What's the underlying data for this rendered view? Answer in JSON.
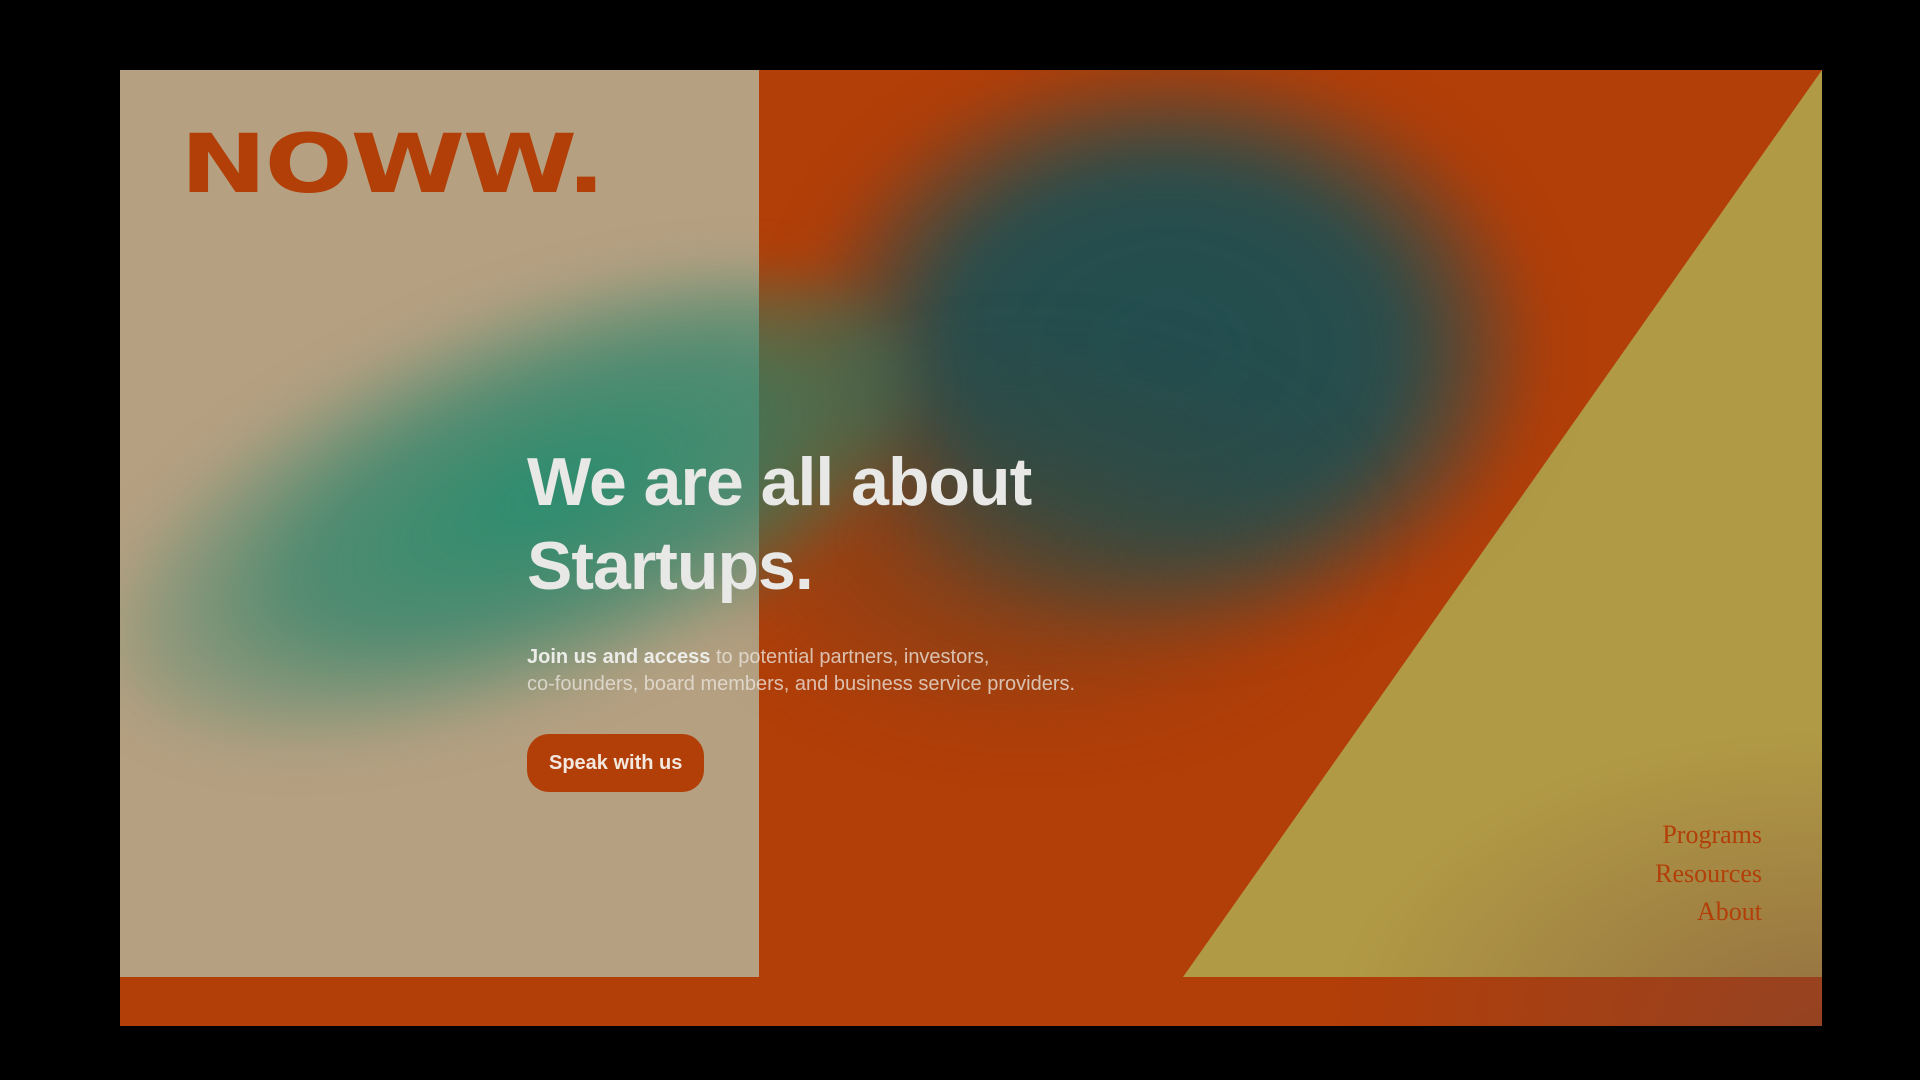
{
  "brand": {
    "logo_text": "NOWW."
  },
  "hero": {
    "headline_line1": "We are all about",
    "headline_line2": "Startups.",
    "sub_strong": "Join us and access",
    "sub_rest_line1": " to potential partners, investors,",
    "sub_line2": "co-founders, board members, and business service providers.",
    "cta_label": "Speak with us"
  },
  "nav": {
    "items": [
      {
        "label": "Programs"
      },
      {
        "label": "Resources"
      },
      {
        "label": "About"
      }
    ]
  },
  "colors": {
    "accent": "#b23e08",
    "beige": "#b5a081",
    "mustard": "#b19a45",
    "teal": "#214e50",
    "green": "#218c6e",
    "text_light": "#e8e8e6",
    "background": "#000000"
  }
}
